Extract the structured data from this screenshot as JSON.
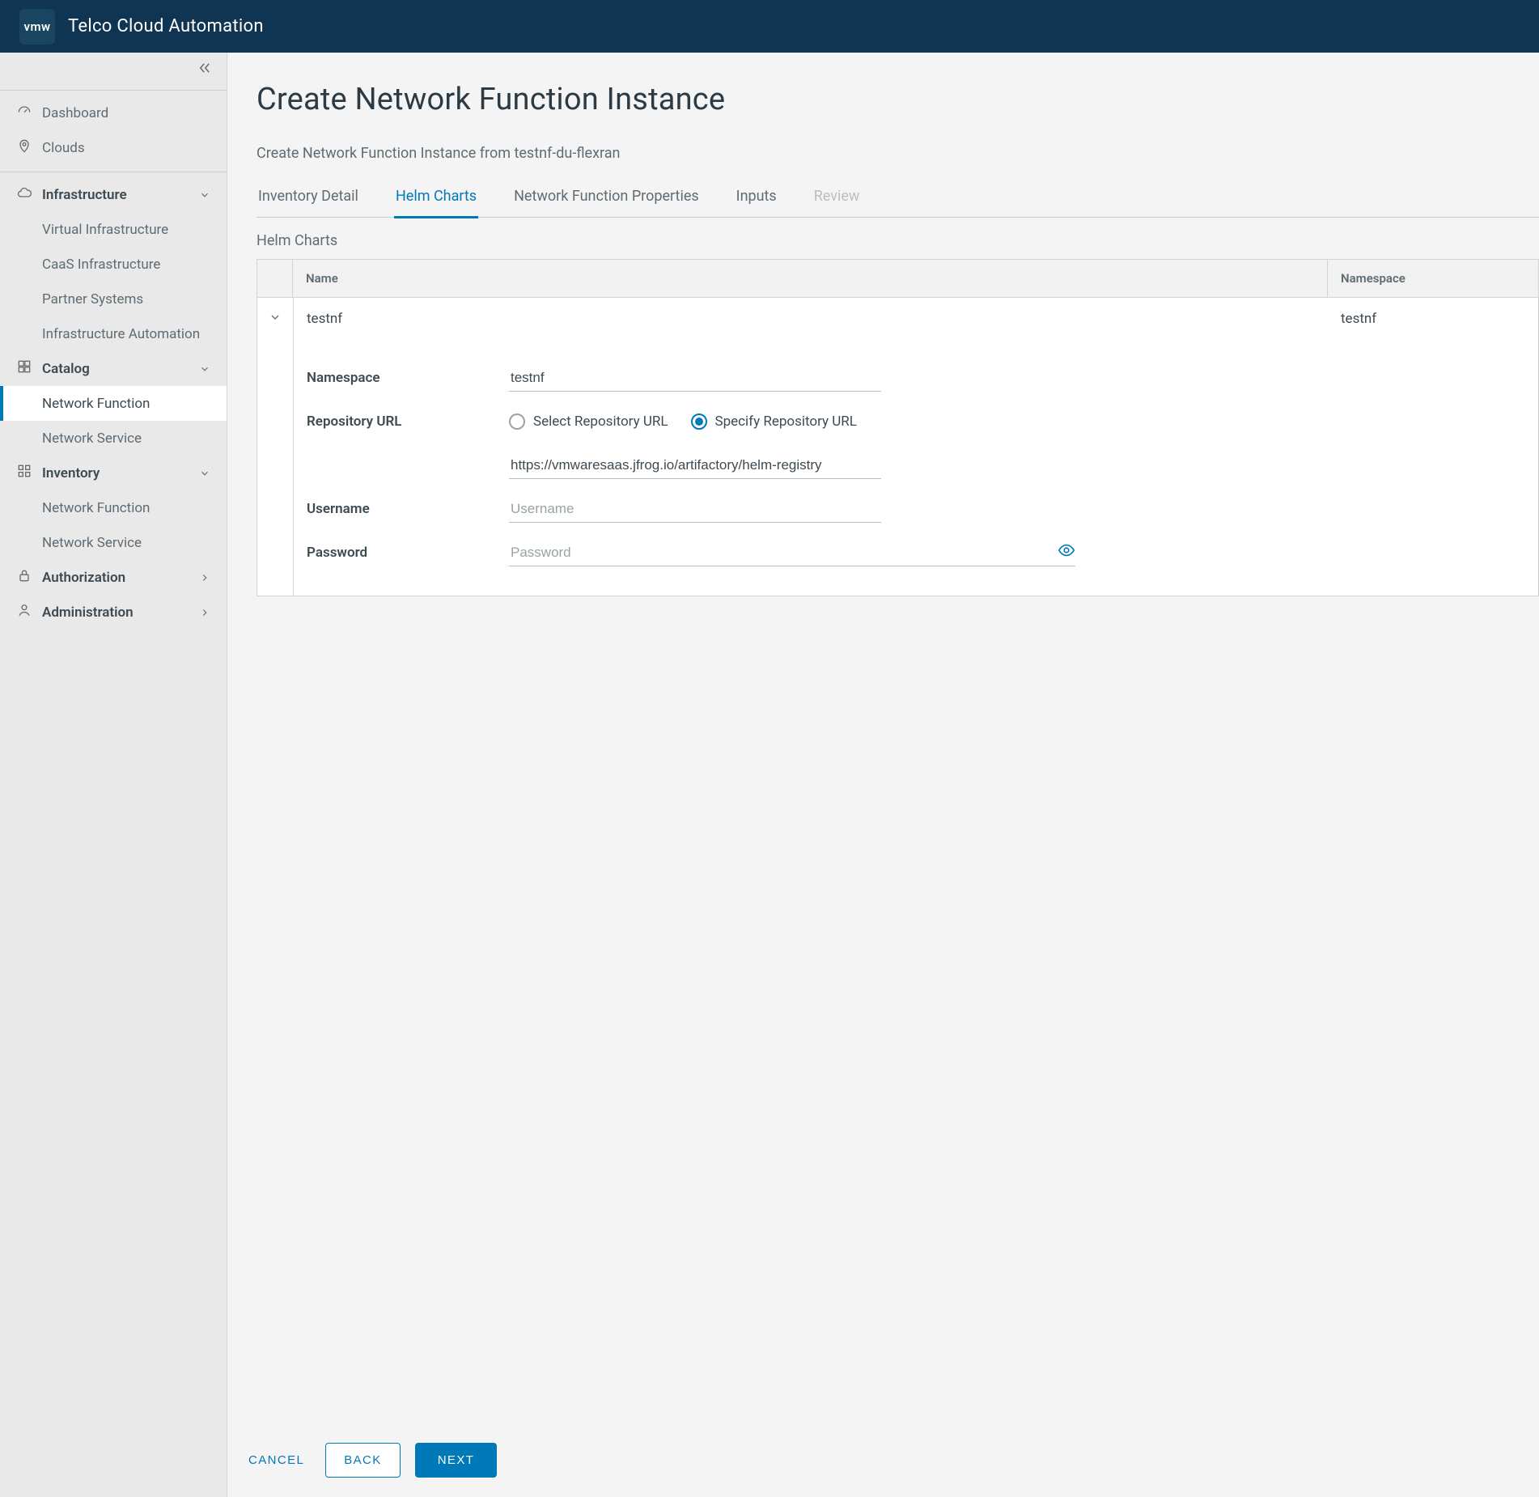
{
  "app": {
    "logo_text": "vmw",
    "title": "Telco Cloud Automation"
  },
  "sidebar": {
    "dashboard": "Dashboard",
    "clouds": "Clouds",
    "infrastructure": {
      "label": "Infrastructure",
      "virtual": "Virtual Infrastructure",
      "caas": "CaaS Infrastructure",
      "partner": "Partner Systems",
      "automation": "Infrastructure Automation"
    },
    "catalog": {
      "label": "Catalog",
      "nf": "Network Function",
      "ns": "Network Service"
    },
    "inventory": {
      "label": "Inventory",
      "nf": "Network Function",
      "ns": "Network Service"
    },
    "authorization": "Authorization",
    "administration": "Administration"
  },
  "page": {
    "title": "Create Network Function Instance",
    "subtitle": "Create Network Function Instance from testnf-du-flexran",
    "section_label": "Helm Charts"
  },
  "tabs": {
    "inventory": "Inventory Detail",
    "helm": "Helm Charts",
    "props": "Network Function Properties",
    "inputs": "Inputs",
    "review": "Review"
  },
  "table": {
    "head_name": "Name",
    "head_namespace": "Namespace",
    "row": {
      "name": "testnf",
      "namespace": "testnf"
    }
  },
  "form": {
    "namespace_label": "Namespace",
    "namespace_value": "testnf",
    "repo_label": "Repository URL",
    "repo_select_label": "Select Repository URL",
    "repo_specify_label": "Specify Repository URL",
    "repo_url_value": "https://vmwaresaas.jfrog.io/artifactory/helm-registry",
    "username_label": "Username",
    "username_placeholder": "Username",
    "password_label": "Password",
    "password_placeholder": "Password"
  },
  "footer": {
    "cancel": "CANCEL",
    "back": "BACK",
    "next": "NEXT"
  }
}
